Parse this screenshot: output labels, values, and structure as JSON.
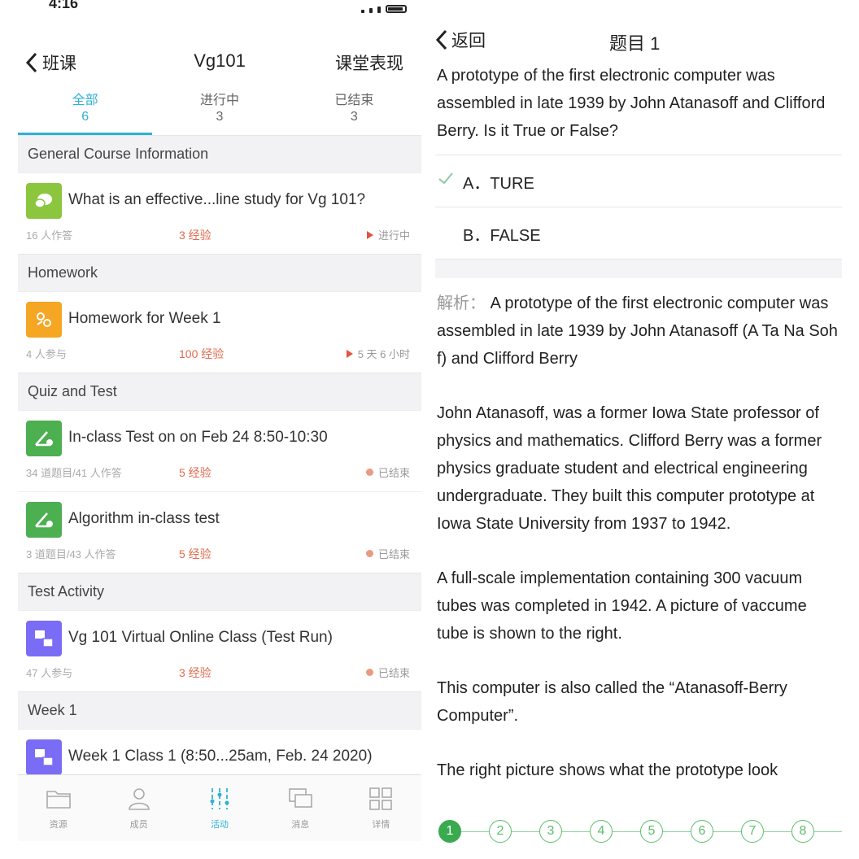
{
  "left": {
    "status": {
      "time": "4:16"
    },
    "nav": {
      "back_label": "班课",
      "title": "Vg101",
      "right_label": "课堂表现"
    },
    "tabs": [
      {
        "label": "全部",
        "count": "6"
      },
      {
        "label": "进行中",
        "count": "3"
      },
      {
        "label": "已结束",
        "count": "3"
      }
    ],
    "sections": [
      {
        "title": "General Course Information",
        "items": [
          {
            "title": "What is an effective...line study for Vg 101?",
            "meta": "16 人作答",
            "xp": "3 经验",
            "status": "进行中",
            "icon": "discussion-icon",
            "color": "#8cc63f"
          }
        ]
      },
      {
        "title": "Homework",
        "items": [
          {
            "title": "Homework for Week 1",
            "meta": "4 人参与",
            "xp": "100 经验",
            "status": "5 天 6 小时",
            "icon": "homework-icon",
            "color": "#f5a623"
          }
        ]
      },
      {
        "title": "Quiz and Test",
        "items": [
          {
            "title": "In-class Test on on Feb 24 8:50-10:30",
            "meta": "34 道题目/41 人作答",
            "xp": "5 经验",
            "status": "已结束",
            "icon": "test-icon",
            "color": "#4caf50"
          },
          {
            "title": "Algorithm in-class test",
            "meta": "3 道题目/43 人作答",
            "xp": "5 经验",
            "status": "已结束",
            "icon": "test-icon",
            "color": "#4caf50"
          }
        ]
      },
      {
        "title": "Test Activity",
        "items": [
          {
            "title": "Vg 101 Virtual Online Class (Test Run)",
            "meta": "47 人参与",
            "xp": "3 经验",
            "status": "已结束",
            "icon": "class-icon",
            "color": "#7b6cf6"
          }
        ]
      },
      {
        "title": "Week 1",
        "items": [
          {
            "title": "Week 1 Class 1 (8:50...25am, Feb. 24 2020)",
            "meta": "",
            "xp": "",
            "status": "",
            "icon": "class-icon",
            "color": "#7b6cf6"
          }
        ]
      }
    ],
    "bottom_nav": [
      {
        "label": "资源",
        "icon": "folder-icon"
      },
      {
        "label": "成员",
        "icon": "person-icon"
      },
      {
        "label": "活动",
        "icon": "activity-icon"
      },
      {
        "label": "消息",
        "icon": "message-icon"
      },
      {
        "label": "详情",
        "icon": "grid-icon"
      }
    ]
  },
  "right": {
    "back_label": "返回",
    "title": "题目 1",
    "question": "A prototype of the first electronic computer was assembled in late 1939 by John Atanasoff and Clifford Berry. Is it True or False?",
    "options": [
      {
        "label": "A．TURE",
        "correct": true
      },
      {
        "label": "B．FALSE",
        "correct": false
      }
    ],
    "analysis_key": "解析：",
    "analysis": [
      "A prototype of the first electronic computer was assembled in late 1939 by John Atanasoff (A Ta Na Soh f) and Clifford Berry",
      "John Atanasoff, was a former Iowa State professor of physics and mathematics. Clifford Berry was a former physics graduate student and electrical engineering undergraduate. They built this computer prototype at Iowa State University from 1937 to 1942.",
      "A full-scale implementation containing 300 vacuum tubes was completed in 1942. A picture of vaccume tube is shown to the right.",
      "This computer is also called the “Atanasoff-Berry Computer”.",
      "The right picture shows what the prototype look"
    ],
    "pager": [
      "1",
      "2",
      "3",
      "4",
      "5",
      "6",
      "7",
      "8"
    ],
    "accent_color": "#3aaa4e"
  }
}
